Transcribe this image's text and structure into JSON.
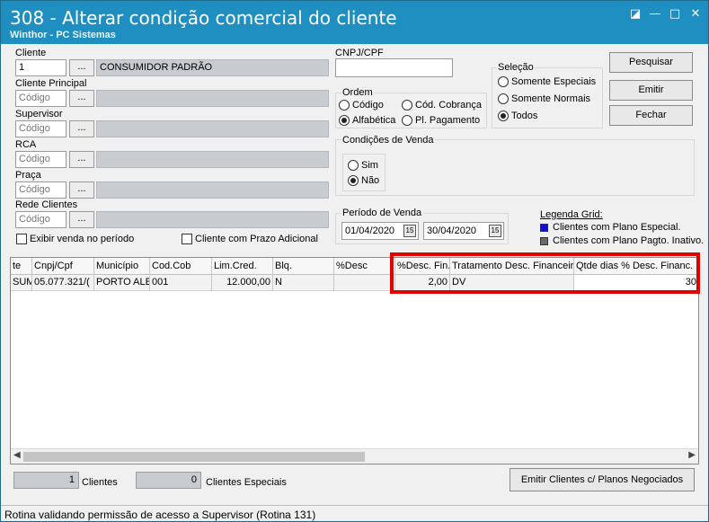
{
  "window": {
    "title": "308 - Alterar condição comercial do cliente",
    "subtitle": "Winthor - PC Sistemas",
    "controls": [
      "◪",
      "—",
      "□",
      "✕"
    ]
  },
  "filters": {
    "cliente": {
      "label": "Cliente",
      "code": "1",
      "name": "CONSUMIDOR PADRÃO"
    },
    "cliente_principal": {
      "label": "Cliente Principal",
      "placeholder": "Código"
    },
    "supervisor": {
      "label": "Supervisor",
      "placeholder": "Código"
    },
    "rca": {
      "label": "RCA",
      "placeholder": "Código"
    },
    "praca": {
      "label": "Praça",
      "placeholder": "Código"
    },
    "rede_clientes": {
      "label": "Rede Clientes",
      "placeholder": "Código"
    },
    "dots_label": "...",
    "exibir_venda": "Exibir venda no período",
    "prazo_adicional": "Cliente com Prazo Adicional"
  },
  "cnpj": {
    "label": "CNPJ/CPF",
    "value": ""
  },
  "ordem": {
    "label": "Ordem",
    "options": [
      "Código",
      "Cód. Cobrança",
      "Alfabética",
      "Pl. Pagamento"
    ],
    "selected": "Alfabética"
  },
  "selecao": {
    "label": "Seleção",
    "options": [
      "Somente Especiais",
      "Somente Normais",
      "Todos"
    ],
    "selected": "Todos"
  },
  "condicoes": {
    "label": "Condições de Venda",
    "options": [
      "Sim",
      "Não"
    ],
    "selected": "Não"
  },
  "periodo": {
    "label": "Período de Venda",
    "start": "01/04/2020",
    "end": "30/04/2020",
    "cal_icon": "15"
  },
  "buttons": {
    "pesquisar": "Pesquisar",
    "emitir": "Emitir",
    "fechar": "Fechar",
    "emitir_clientes": "Emitir Clientes c/ Planos Negociados"
  },
  "legend": {
    "title": "Legenda Grid:",
    "items": [
      {
        "label": "Clientes com Plano Especial.",
        "color": "#1010d0"
      },
      {
        "label": "Clientes com Plano Pagto. Inativo.",
        "color": "#6a6a6a"
      }
    ]
  },
  "grid": {
    "columns": [
      "te",
      "Cnpj/Cpf",
      "Município",
      "Cod.Cob",
      "Lim.Cred.",
      "Blq.",
      "%Desc",
      "%Desc. Fin.",
      "Tratamento Desc. Financeir",
      "Qtde dias % Desc. Financ."
    ],
    "rows": [
      [
        "SUMI",
        "05.077.321/(",
        "PORTO ALE(",
        "001",
        "12.000,00",
        "N",
        "",
        "2,00",
        "DV",
        "30"
      ]
    ]
  },
  "footer": {
    "clientes_count": "1",
    "clientes_label": "Clientes",
    "especiais_count": "0",
    "especiais_label": "Clientes Especiais"
  },
  "status": "Rotina validando permissão de acesso a Supervisor (Rotina 131)",
  "accent": "#e10000"
}
